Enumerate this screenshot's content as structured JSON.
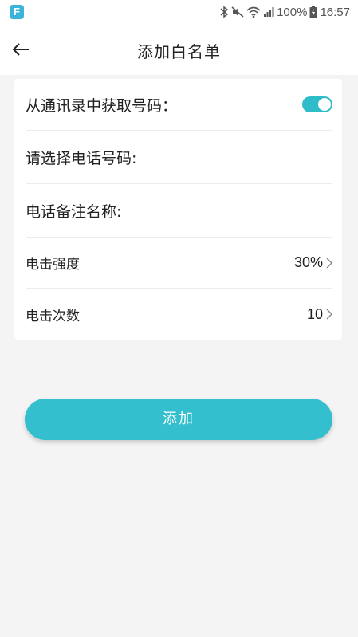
{
  "status_bar": {
    "app_badge": "F",
    "battery": "100%",
    "time": "16:57",
    "icons": [
      "bluetooth-icon",
      "mute-icon",
      "wifi-icon",
      "signal-icon",
      "battery-icon"
    ]
  },
  "header": {
    "title": "添加白名单",
    "back_icon": "arrow-left-icon"
  },
  "form": {
    "contacts_label": "从通讯录中获取号码：",
    "contacts_toggle_on": true,
    "select_phone_label": "请选择电话号码:",
    "remark_label": "电话备注名称:",
    "strength_label": "电击强度",
    "strength_value": "30%",
    "times_label": "电击次数",
    "times_value": "10"
  },
  "actions": {
    "add_label": "添加"
  },
  "colors": {
    "accent": "#33bfcd",
    "background": "#f4f4f4",
    "card": "#ffffff"
  }
}
